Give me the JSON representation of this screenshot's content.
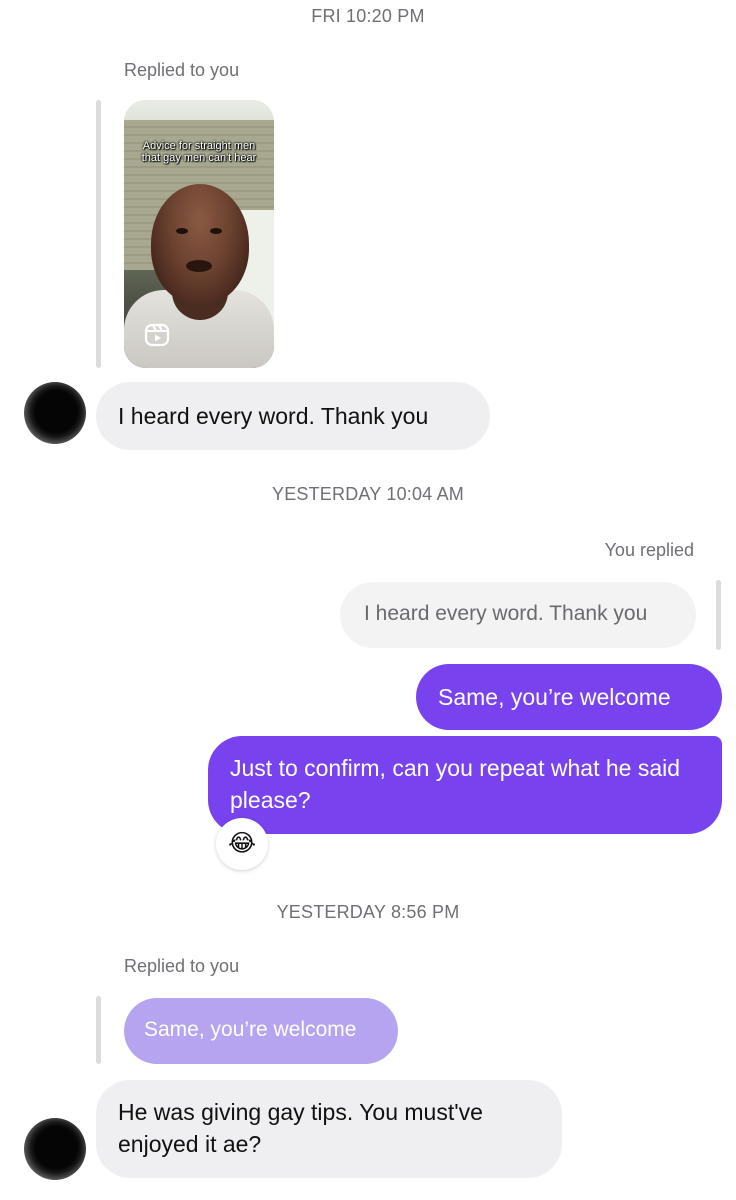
{
  "thread": {
    "timestamp_1": "FRI 10:20 PM",
    "reply_label_1": "Replied to you",
    "reel": {
      "caption": "Advice for straight men that gay men can't hear",
      "icon": "reels-icon"
    },
    "msg_1": "I heard every word. Thank you",
    "timestamp_2": "YESTERDAY 10:04 AM",
    "you_replied_label": "You replied",
    "quoted_1": "I heard every word. Thank you",
    "msg_2": "Same, you’re welcome",
    "msg_3": "Just to confirm, can you repeat what he said please?",
    "reaction": "😂",
    "timestamp_3": "YESTERDAY 8:56 PM",
    "reply_label_2": "Replied to you",
    "quoted_2": "Same, you’re welcome",
    "msg_4": "He was giving gay tips. You must've enjoyed it ae?"
  },
  "colors": {
    "outgoing_bubble": "#7843ee",
    "incoming_bubble": "#efeff1",
    "quoted_outgoing": "#b6a4f1",
    "meta_text": "#6f6f74"
  }
}
